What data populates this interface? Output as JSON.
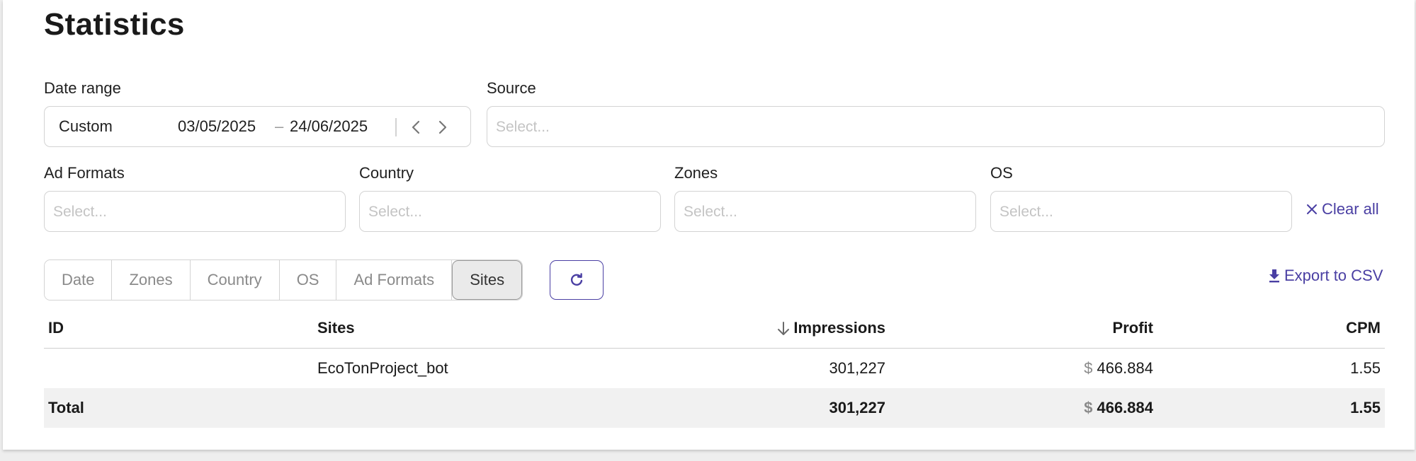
{
  "page": {
    "title": "Statistics"
  },
  "filters": {
    "date_range": {
      "label": "Date range",
      "preset": "Custom",
      "start": "03/05/2025",
      "separator": "–",
      "end": "24/06/2025"
    },
    "source": {
      "label": "Source",
      "placeholder": "Select..."
    },
    "ad_formats": {
      "label": "Ad Formats",
      "placeholder": "Select..."
    },
    "country": {
      "label": "Country",
      "placeholder": "Select..."
    },
    "zones": {
      "label": "Zones",
      "placeholder": "Select..."
    },
    "os": {
      "label": "OS",
      "placeholder": "Select..."
    },
    "clear_all": "Clear all"
  },
  "group_tabs": [
    {
      "label": "Date"
    },
    {
      "label": "Zones"
    },
    {
      "label": "Country"
    },
    {
      "label": "OS"
    },
    {
      "label": "Ad Formats"
    },
    {
      "label": "Sites",
      "active": true
    }
  ],
  "actions": {
    "export": "Export to CSV"
  },
  "table": {
    "columns": {
      "id": "ID",
      "sites": "Sites",
      "impressions": "Impressions",
      "profit": "Profit",
      "cpm": "CPM"
    },
    "sort_column": "impressions",
    "rows": [
      {
        "id": "",
        "site": "EcoTonProject_bot",
        "impressions": "301,227",
        "currency": "$",
        "profit": "466.884",
        "cpm": "1.55"
      }
    ],
    "total": {
      "label": "Total",
      "impressions": "301,227",
      "currency": "$",
      "profit": "466.884",
      "cpm": "1.55"
    }
  },
  "colors": {
    "accent": "#4a3fa3",
    "border": "#d3d3d3",
    "total_row_bg": "#f1f1f1"
  }
}
